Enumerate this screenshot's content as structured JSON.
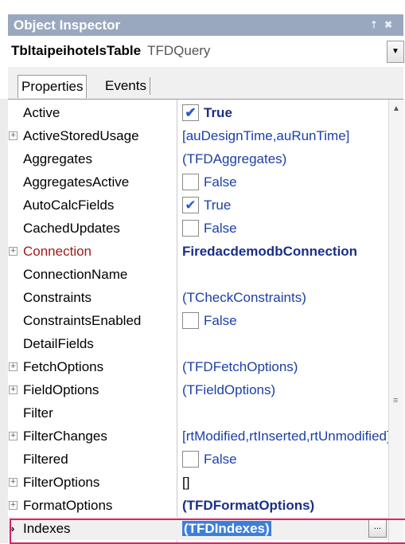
{
  "window": {
    "title": "Object Inspector",
    "pin_glyph": "⇡",
    "close_glyph": "✖"
  },
  "object_selector": {
    "name": "TbltaipeihotelsTable",
    "type": "TFDQuery",
    "dropdown_glyph": "▼"
  },
  "tabs": {
    "properties": "Properties",
    "events": "Events"
  },
  "properties": [
    {
      "name": "Active",
      "value": "True",
      "kind": "bool",
      "checked": true,
      "bold": true,
      "expandable": false
    },
    {
      "name": "ActiveStoredUsage",
      "value": "[auDesignTime,auRunTime]",
      "kind": "text",
      "expandable": true
    },
    {
      "name": "Aggregates",
      "value": "(TFDAggregates)",
      "kind": "text",
      "expandable": false
    },
    {
      "name": "AggregatesActive",
      "value": "False",
      "kind": "bool",
      "checked": false,
      "expandable": false
    },
    {
      "name": "AutoCalcFields",
      "value": "True",
      "kind": "bool",
      "checked": true,
      "expandable": false
    },
    {
      "name": "CachedUpdates",
      "value": "False",
      "kind": "bool",
      "checked": false,
      "expandable": false
    },
    {
      "name": "Connection",
      "value": "FiredacdemodbConnection",
      "kind": "text",
      "bold": true,
      "red_name": true,
      "expandable": true
    },
    {
      "name": "ConnectionName",
      "value": "",
      "kind": "text",
      "expandable": false
    },
    {
      "name": "Constraints",
      "value": "(TCheckConstraints)",
      "kind": "text",
      "expandable": false
    },
    {
      "name": "ConstraintsEnabled",
      "value": "False",
      "kind": "bool",
      "checked": false,
      "expandable": false
    },
    {
      "name": "DetailFields",
      "value": "",
      "kind": "text",
      "expandable": false
    },
    {
      "name": "FetchOptions",
      "value": "(TFDFetchOptions)",
      "kind": "text",
      "expandable": true
    },
    {
      "name": "FieldOptions",
      "value": "(TFieldOptions)",
      "kind": "text",
      "expandable": true
    },
    {
      "name": "Filter",
      "value": "",
      "kind": "text",
      "expandable": false
    },
    {
      "name": "FilterChanges",
      "value": "[rtModified,rtInserted,rtUnmodified]",
      "kind": "text",
      "expandable": true
    },
    {
      "name": "Filtered",
      "value": "False",
      "kind": "bool",
      "checked": false,
      "expandable": false
    },
    {
      "name": "FilterOptions",
      "value": "[]",
      "kind": "text",
      "black": true,
      "expandable": true
    },
    {
      "name": "FormatOptions",
      "value": "(TFDFormatOptions)",
      "kind": "text",
      "bold": true,
      "expandable": true
    },
    {
      "name": "Indexes",
      "value": "(TFDIndexes)",
      "kind": "text",
      "selected": true,
      "expandable": false
    }
  ],
  "icons": {
    "expander": "plus-box-icon",
    "checkmark": "✔",
    "current_row_marker": "»",
    "ellipsis": "...",
    "scroll_up": "▲",
    "scroll_grip": "≡"
  },
  "colors": {
    "title_bar": "#9aa8bf",
    "value_text": "#1c3fa8",
    "modified_name": "#9b1b1b",
    "selection": "#3c7fd9",
    "highlight_box": "#e0206a"
  }
}
